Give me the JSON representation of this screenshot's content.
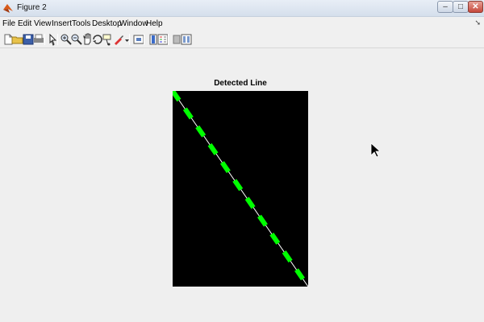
{
  "window": {
    "title": "Figure 2"
  },
  "menu": [
    "File",
    "Edit",
    "View",
    "Insert",
    "Tools",
    "Desktop",
    "Window",
    "Help"
  ],
  "toolbar": {
    "buttons": [
      "new-figure",
      "open-file",
      "save-figure",
      "print-figure",
      "edit-plot",
      "zoom-in",
      "zoom-out",
      "pan",
      "rotate-3d",
      "data-cursor",
      "brush",
      "link-plot",
      "insert-colorbar",
      "insert-legend",
      "hide-plot-tools",
      "show-plot-tools"
    ]
  },
  "figure": {
    "title": "Detected Line",
    "line_color": "#00ff00",
    "axes_color": "#000000"
  }
}
